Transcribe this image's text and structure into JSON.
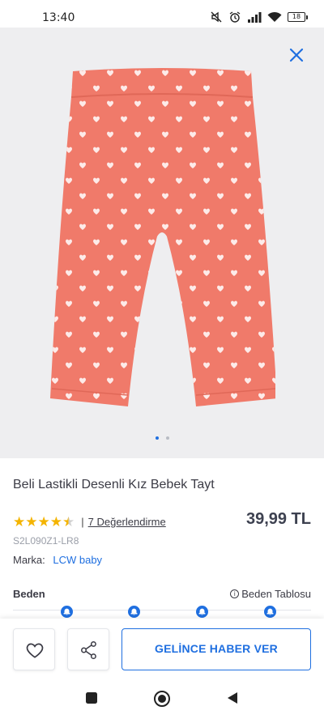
{
  "status_bar": {
    "time": "13:40",
    "battery_level": "18",
    "icons": [
      "mute-icon",
      "alarm-icon",
      "signal-icon",
      "wifi-icon",
      "battery-icon"
    ]
  },
  "gallery": {
    "close_icon": "close-icon",
    "image_count": 2,
    "active_index": 0,
    "product_color": "#f07a6a"
  },
  "product": {
    "title": "Beli Lastikli Desenli Kız Bebek Tayt",
    "rating": 4.5,
    "rating_separator": "|",
    "rating_link": "7 Değerlendirme",
    "price": "39,99 TL",
    "sku": "S2L090Z1-LR8",
    "brand_label": "Marka:",
    "brand_name": "LCW baby"
  },
  "size": {
    "label": "Beden",
    "table_link": "Beden Tablosu",
    "notify_icon": "bell-icon"
  },
  "actions": {
    "favorite_icon": "heart-icon",
    "share_icon": "share-icon",
    "notify_label": "GELİNCE HABER VER"
  },
  "nav": {
    "icons": [
      "recent-apps-icon",
      "home-icon",
      "back-icon"
    ]
  },
  "colors": {
    "accent": "#1f6fe0",
    "star": "#f4b400",
    "background_gallery": "#eeeef0"
  }
}
